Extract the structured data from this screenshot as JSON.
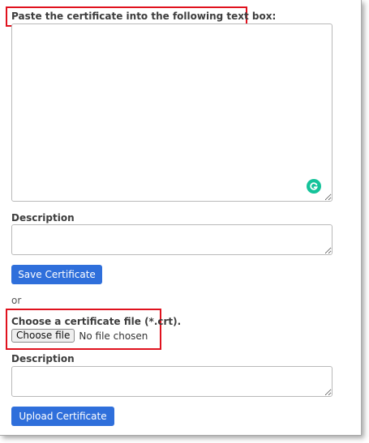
{
  "paste_section": {
    "label": "Paste the certificate into the following text box:",
    "textarea_value": ""
  },
  "paste_description": {
    "label": "Description",
    "value": ""
  },
  "save_button": {
    "label": "Save Certificate"
  },
  "separator": {
    "text": "or"
  },
  "file_section": {
    "label": "Choose a certificate file (*.crt).",
    "choose_button_label": "Choose file",
    "status": "No file chosen"
  },
  "upload_description": {
    "label": "Description",
    "value": ""
  },
  "upload_button": {
    "label": "Upload Certificate"
  },
  "icons": {
    "textarea_assistant": "grammarly-icon"
  },
  "colors": {
    "primary_button": "#2f6fdb",
    "highlight_border": "#e0121e",
    "assistant_icon": "#15c39a"
  }
}
